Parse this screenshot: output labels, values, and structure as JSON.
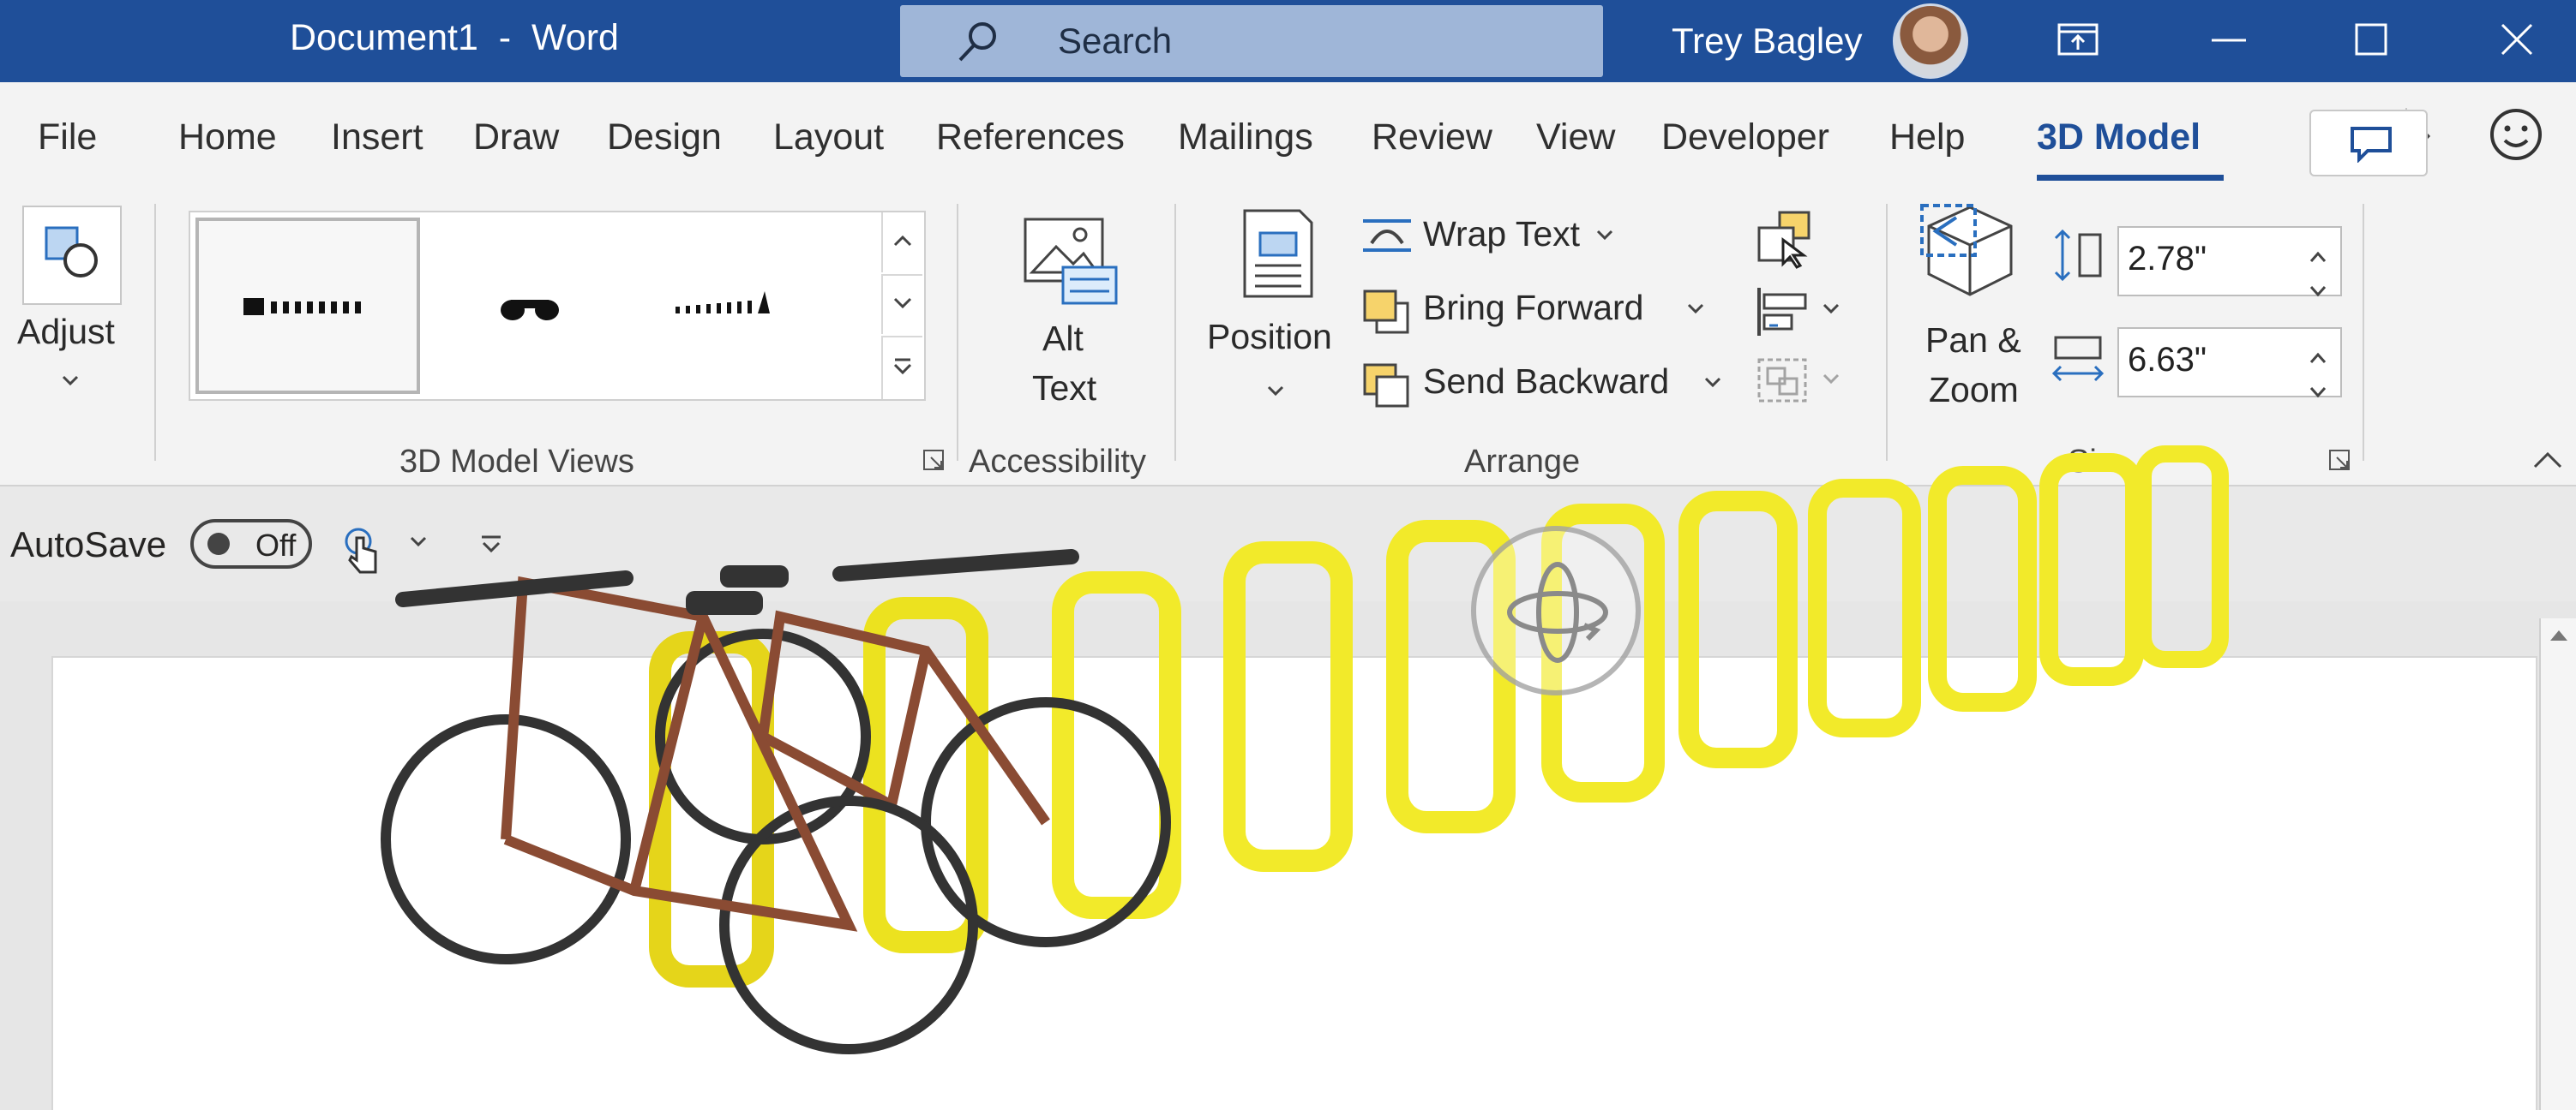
{
  "window": {
    "title": "Document1  -  Word",
    "user_name": "Trey Bagley"
  },
  "search": {
    "label": "Search"
  },
  "tabs": [
    "File",
    "Home",
    "Insert",
    "Draw",
    "Design",
    "Layout",
    "References",
    "Mailings",
    "Review",
    "View",
    "Developer",
    "Help",
    "3D Model"
  ],
  "active_tab": "3D Model",
  "ribbon": {
    "adjust": {
      "label": "Adjust"
    },
    "views_group": {
      "label": "3D Model Views"
    },
    "accessibility": {
      "alt_line1": "Alt",
      "alt_line2": "Text",
      "group_label": "Accessibility"
    },
    "arrange": {
      "position_label": "Position",
      "wrap_text": "Wrap Text",
      "bring_forward": "Bring Forward",
      "send_backward": "Send Backward",
      "group_label": "Arrange"
    },
    "size": {
      "pan_zoom_line1": "Pan &",
      "pan_zoom_line2": "Zoom",
      "height_value": "2.78\"",
      "width_value": "6.63\"",
      "group_label_visible": "Si"
    }
  },
  "qat": {
    "autosave_label": "AutoSave",
    "toggle_label": "Off"
  },
  "colors": {
    "title_bar": "#1f4f99",
    "accent": "#1f4f99",
    "rack_yellow": "#f2ea2a",
    "bike_frame": "#8a4b33"
  },
  "icons": [
    "search-icon",
    "minimize-icon",
    "maximize-icon",
    "close-icon",
    "restore-icon",
    "comments-icon",
    "smiley-icon",
    "touch-mode-icon",
    "chevron-down-icon",
    "rotate-3d-icon"
  ]
}
